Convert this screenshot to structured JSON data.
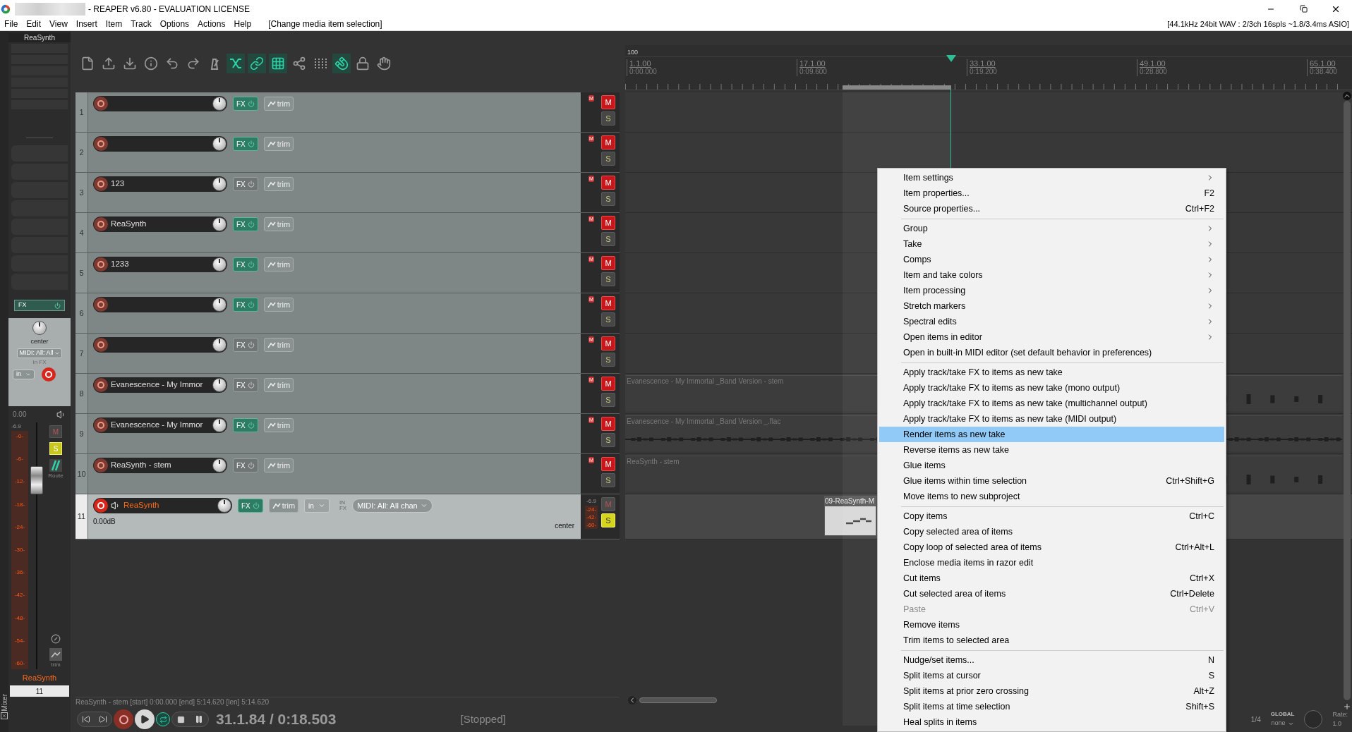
{
  "window": {
    "title": "- REAPER v6.80 - EVALUATION LICENSE"
  },
  "menu_bar": {
    "items": [
      "File",
      "Edit",
      "View",
      "Insert",
      "Item",
      "Track",
      "Options",
      "Actions",
      "Help"
    ],
    "action_hint": "[Change media item selection]",
    "audio_status": "[44.1kHz 24bit WAV : 2/3ch 16spls ~1.8/3.4ms ASIO]"
  },
  "toolbar": [
    {
      "kind": "file",
      "active": false
    },
    {
      "kind": "upload",
      "active": false
    },
    {
      "kind": "download",
      "active": false
    },
    {
      "kind": "info",
      "active": false
    },
    {
      "kind": "undo",
      "active": false
    },
    {
      "kind": "redo",
      "active": false
    },
    {
      "kind": "metronome",
      "active": false
    },
    {
      "kind": "crossfade",
      "active": true
    },
    {
      "kind": "link",
      "active": true
    },
    {
      "kind": "grid",
      "active": true
    },
    {
      "kind": "share",
      "active": false
    },
    {
      "kind": "dots",
      "active": false
    },
    {
      "kind": "magnet",
      "active": true
    },
    {
      "kind": "lock",
      "active": false
    },
    {
      "kind": "hand",
      "active": false
    }
  ],
  "mixer_strip": {
    "top_label": "ReaSynth",
    "fx_label": "FX",
    "fx_active": true,
    "pan": "center",
    "midi_input": "MIDI: All: All",
    "input_fx": "In FX",
    "input": "in",
    "volume": "0.00",
    "peak": "-6.9",
    "mute_label": "M",
    "muted": false,
    "solo_label": "S",
    "soloed": true,
    "route": "Route",
    "trim": "trim",
    "meter_scale": [
      "-0-",
      "-6-",
      "-12-",
      "-18-",
      "-24-",
      "-30-",
      "-36-",
      "-42-",
      "-48-",
      "-54-",
      "-60-"
    ],
    "name": "ReaSynth",
    "number": "11",
    "panel_label": "Mixer"
  },
  "tracks": [
    {
      "number": "1",
      "fx_label": "FX",
      "fx_active": true,
      "trim_label": "trim",
      "mute_badge": "M",
      "mute_label": "M",
      "muted": true,
      "solo_label": "S",
      "soloed": false,
      "selected": false
    },
    {
      "number": "2",
      "fx_label": "FX",
      "fx_active": true,
      "trim_label": "trim",
      "mute_badge": "M",
      "mute_label": "M",
      "muted": true,
      "solo_label": "S",
      "soloed": false,
      "selected": false
    },
    {
      "number": "3",
      "name": "123",
      "fx_label": "FX",
      "fx_active": false,
      "trim_label": "trim",
      "mute_badge": "M",
      "mute_label": "M",
      "muted": true,
      "solo_label": "S",
      "soloed": false,
      "selected": false
    },
    {
      "number": "4",
      "name": "ReaSynth",
      "fx_label": "FX",
      "fx_active": true,
      "trim_label": "trim",
      "mute_badge": "M",
      "mute_label": "M",
      "muted": true,
      "solo_label": "S",
      "soloed": false,
      "selected": false
    },
    {
      "number": "5",
      "name": "1233",
      "fx_label": "FX",
      "fx_active": true,
      "trim_label": "trim",
      "mute_badge": "M",
      "mute_label": "M",
      "muted": true,
      "solo_label": "S",
      "soloed": false,
      "selected": false
    },
    {
      "number": "6",
      "fx_label": "FX",
      "fx_active": true,
      "trim_label": "trim",
      "mute_badge": "M",
      "mute_label": "M",
      "muted": true,
      "solo_label": "S",
      "soloed": false,
      "selected": false
    },
    {
      "number": "7",
      "fx_label": "FX",
      "fx_active": false,
      "trim_label": "trim",
      "mute_badge": "M",
      "mute_label": "M",
      "muted": true,
      "solo_label": "S",
      "soloed": false,
      "selected": false
    },
    {
      "number": "8",
      "name": "Evanescence - My Immor",
      "fx_label": "FX",
      "fx_active": false,
      "trim_label": "trim",
      "mute_badge": "M",
      "mute_label": "M",
      "muted": true,
      "solo_label": "S",
      "soloed": false,
      "selected": false,
      "item": {
        "kind": "audio",
        "label": "Evanescence - My Immortal _Band Version - stem"
      }
    },
    {
      "number": "9",
      "name": "Evanescence - My Immor",
      "fx_label": "FX",
      "fx_active": true,
      "trim_label": "trim",
      "mute_badge": "M",
      "mute_label": "M",
      "muted": true,
      "solo_label": "S",
      "soloed": false,
      "selected": false,
      "item": {
        "kind": "audio",
        "label": "Evanescence - My Immortal _Band Version _.flac"
      }
    },
    {
      "number": "10",
      "name": "ReaSynth - stem",
      "fx_label": "FX",
      "fx_active": false,
      "trim_label": "trim",
      "mute_badge": "M",
      "mute_label": "M",
      "muted": true,
      "solo_label": "S",
      "soloed": false,
      "selected": false,
      "item": {
        "kind": "audio",
        "label": "ReaSynth - stem"
      }
    },
    {
      "number": "11",
      "name": "ReaSynth",
      "fx_label": "FX",
      "fx_active": true,
      "trim_label": "trim",
      "mute_label": "M",
      "muted": false,
      "solo_label": "S",
      "soloed": true,
      "selected": true,
      "volume": "0.00dB",
      "pan": "center",
      "input": "in",
      "in_fx": [
        "IN",
        "FX"
      ],
      "midi_input": "MIDI: All: All chan",
      "peak": "-6.9",
      "meter_scale": [
        "-24-",
        "-42-",
        "-60-"
      ],
      "item": {
        "kind": "midi",
        "label": "09-ReaSynth-M"
      }
    }
  ],
  "ruler": {
    "tempo": "100",
    "marks": [
      {
        "bar": "1.1.00",
        "time": "0:00.000"
      },
      {
        "bar": "17.1.00",
        "time": "0:09.600"
      },
      {
        "bar": "33.1.00",
        "time": "0:19.200"
      },
      {
        "bar": "49.1.00",
        "time": "0:28.800"
      },
      {
        "bar": "65.1.00",
        "time": "0:38.400"
      }
    ]
  },
  "context_menu": [
    [
      {
        "label": "Item settings",
        "kind": "submenu",
        "disabled": false,
        "selected": false
      },
      {
        "label": "Item properties...",
        "shortcut": "F2",
        "kind": "action",
        "disabled": false,
        "selected": false
      },
      {
        "label": "Source properties...",
        "shortcut": "Ctrl+F2",
        "kind": "action",
        "disabled": false,
        "selected": false
      }
    ],
    [
      {
        "label": "Group",
        "kind": "submenu",
        "disabled": false,
        "selected": false
      },
      {
        "label": "Take",
        "kind": "submenu",
        "disabled": false,
        "selected": false
      },
      {
        "label": "Comps",
        "kind": "submenu",
        "disabled": false,
        "selected": false
      },
      {
        "label": "Item and take colors",
        "kind": "submenu",
        "disabled": false,
        "selected": false
      },
      {
        "label": "Item processing",
        "kind": "submenu",
        "disabled": false,
        "selected": false
      },
      {
        "label": "Stretch markers",
        "kind": "submenu",
        "disabled": false,
        "selected": false
      },
      {
        "label": "Spectral edits",
        "kind": "submenu",
        "disabled": false,
        "selected": false
      },
      {
        "label": "Open items in editor",
        "kind": "submenu",
        "disabled": false,
        "selected": false
      },
      {
        "label": "Open in built-in MIDI editor (set default behavior in preferences)",
        "kind": "action",
        "disabled": false,
        "selected": false
      }
    ],
    [
      {
        "label": "Apply track/take FX to items as new take",
        "kind": "action",
        "disabled": false,
        "selected": false
      },
      {
        "label": "Apply track/take FX to items as new take (mono output)",
        "kind": "action",
        "disabled": false,
        "selected": false
      },
      {
        "label": "Apply track/take FX to items as new take (multichannel output)",
        "kind": "action",
        "disabled": false,
        "selected": false
      },
      {
        "label": "Apply track/take FX to items as new take (MIDI output)",
        "kind": "action",
        "disabled": false,
        "selected": false
      },
      {
        "label": "Render items as new take",
        "kind": "action",
        "disabled": false,
        "selected": true
      },
      {
        "label": "Reverse items as new take",
        "kind": "action",
        "disabled": false,
        "selected": false
      },
      {
        "label": "Glue items",
        "kind": "action",
        "disabled": false,
        "selected": false
      },
      {
        "label": "Glue items within time selection",
        "shortcut": "Ctrl+Shift+G",
        "kind": "action",
        "disabled": false,
        "selected": false
      },
      {
        "label": "Move items to new subproject",
        "kind": "action",
        "disabled": false,
        "selected": false
      }
    ],
    [
      {
        "label": "Copy items",
        "shortcut": "Ctrl+C",
        "kind": "action",
        "disabled": false,
        "selected": false
      },
      {
        "label": "Copy selected area of items",
        "kind": "action",
        "disabled": false,
        "selected": false
      },
      {
        "label": "Copy loop of selected area of items",
        "shortcut": "Ctrl+Alt+L",
        "kind": "action",
        "disabled": false,
        "selected": false
      },
      {
        "label": "Enclose media items in razor edit",
        "kind": "action",
        "disabled": false,
        "selected": false
      },
      {
        "label": "Cut items",
        "shortcut": "Ctrl+X",
        "kind": "action",
        "disabled": false,
        "selected": false
      },
      {
        "label": "Cut selected area of items",
        "shortcut": "Ctrl+Delete",
        "kind": "action",
        "disabled": false,
        "selected": false
      },
      {
        "label": "Paste",
        "shortcut": "Ctrl+V",
        "kind": "action",
        "disabled": true,
        "selected": false
      },
      {
        "label": "Remove items",
        "kind": "action",
        "disabled": false,
        "selected": false
      },
      {
        "label": "Trim items to selected area",
        "kind": "action",
        "disabled": false,
        "selected": false
      }
    ],
    [
      {
        "label": "Nudge/set items...",
        "shortcut": "N",
        "kind": "action",
        "disabled": false,
        "selected": false
      },
      {
        "label": "Split items at cursor",
        "shortcut": "S",
        "kind": "action",
        "disabled": false,
        "selected": false
      },
      {
        "label": "Split items at prior zero crossing",
        "shortcut": "Alt+Z",
        "kind": "action",
        "disabled": false,
        "selected": false
      },
      {
        "label": "Split items at time selection",
        "shortcut": "Shift+S",
        "kind": "action",
        "disabled": false,
        "selected": false
      },
      {
        "label": "Heal splits in items",
        "kind": "action",
        "disabled": false,
        "selected": false
      }
    ]
  ],
  "status_line": "ReaSynth - stem [start] 0:00.000 [end] 5:14.620 [len] 5:14.620",
  "transport": {
    "position": "31.1.84 / 0:18.503",
    "state": "[Stopped]"
  },
  "corner": {
    "grid": "1/4",
    "automation_mode": "GLOBAL",
    "automation_value": "none",
    "rate_label": "Rate:",
    "rate": "1.0"
  }
}
